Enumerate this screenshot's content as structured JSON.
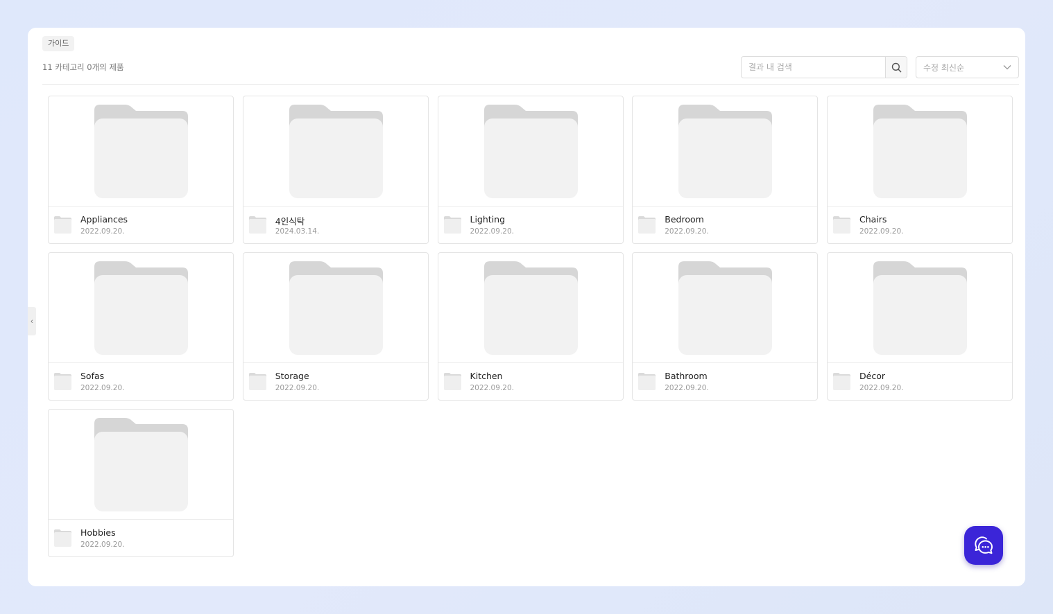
{
  "breadcrumb": "가이드",
  "summary": "11 카테고리 0개의 제품",
  "search": {
    "placeholder": "결과 내 검색",
    "value": ""
  },
  "sort": {
    "selected": "수정 최신순"
  },
  "side_toggle": "‹",
  "icons": {
    "search": "search-icon",
    "chevron": "chevron-down-icon",
    "folder": "folder-icon",
    "chat": "chat-icon",
    "collapse": "chevron-left-icon"
  },
  "colors": {
    "background": "#dfe8fb",
    "folder_light": "#f2f2f2",
    "folder_tab": "#d6d6d6",
    "chat_button": "#3b25d8"
  },
  "categories": [
    {
      "name": "Appliances",
      "date": "2022.09.20."
    },
    {
      "name": "4인식탁",
      "date": "2024.03.14."
    },
    {
      "name": "Lighting",
      "date": "2022.09.20."
    },
    {
      "name": "Bedroom",
      "date": "2022.09.20."
    },
    {
      "name": "Chairs",
      "date": "2022.09.20."
    },
    {
      "name": "Sofas",
      "date": "2022.09.20."
    },
    {
      "name": "Storage",
      "date": "2022.09.20."
    },
    {
      "name": "Kitchen",
      "date": "2022.09.20."
    },
    {
      "name": "Bathroom",
      "date": "2022.09.20."
    },
    {
      "name": "Décor",
      "date": "2022.09.20."
    },
    {
      "name": "Hobbies",
      "date": "2022.09.20."
    }
  ]
}
